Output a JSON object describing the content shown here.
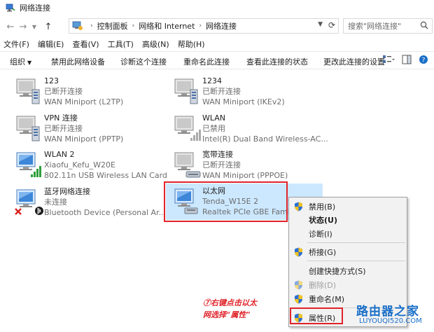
{
  "window": {
    "title": "网络连接"
  },
  "address": {
    "crumbs": [
      "控制面板",
      "网络和 Internet",
      "网络连接"
    ]
  },
  "search": {
    "placeholder": "搜索\"网络连接\""
  },
  "menu": [
    "文件(F)",
    "编辑(E)",
    "查看(V)",
    "工具(T)",
    "高级(N)",
    "帮助(H)"
  ],
  "commands": {
    "organize": "组织",
    "disable": "禁用此网络设备",
    "diagnose": "诊断这个连接",
    "rename": "重命名此连接",
    "view_status": "查看此连接的状态",
    "change_settings": "更改此连接的设置"
  },
  "connections": [
    {
      "name": "123",
      "status": "已断开连接",
      "device": "WAN Miniport (L2TP)"
    },
    {
      "name": "1234",
      "status": "已断开连接",
      "device": "WAN Miniport (IKEv2)"
    },
    {
      "name": "VPN 连接",
      "status": "已断开连接",
      "device": "WAN Miniport (PPTP)"
    },
    {
      "name": "WLAN",
      "status": "已禁用",
      "device": "Intel(R) Dual Band Wireless-AC..."
    },
    {
      "name": "WLAN 2",
      "status": "Xiaofu_Kefu_W20E",
      "device": "802.11n USB Wireless LAN Card"
    },
    {
      "name": "宽带连接",
      "status": "已断开连接",
      "device": "WAN Miniport (PPPOE)"
    },
    {
      "name": "蓝牙网络连接",
      "status": "未连接",
      "device": "Bluetooth Device (Personal Ar..."
    },
    {
      "name": "以太网",
      "status": "Tenda_W15E  2",
      "device": "Realtek PCIe GBE Family"
    }
  ],
  "context_menu": {
    "disable": "禁用(B)",
    "status": "状态(U)",
    "diagnose": "诊断(I)",
    "bridge": "桥接(G)",
    "shortcut": "创建快捷方式(S)",
    "delete": "删除(D)",
    "rename": "重命名(M)",
    "properties": "属性(R)"
  },
  "annotation": {
    "line1": "⑦右键点击以太",
    "line2": "网选择“属性”"
  },
  "watermark": {
    "main": "路由器之家",
    "sub": "LUYOUQI520.COM"
  },
  "colors": {
    "accent": "#1a6fc8",
    "highlight": "#e0242b",
    "selection": "#cce8ff"
  }
}
